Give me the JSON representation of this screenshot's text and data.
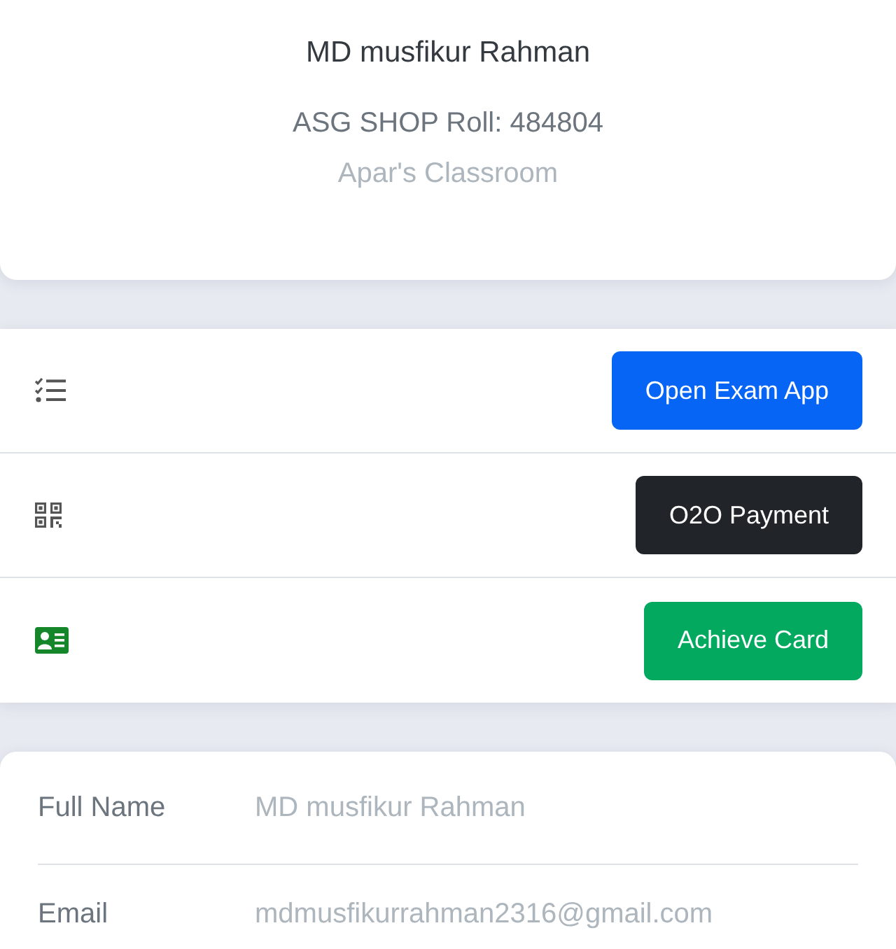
{
  "profile": {
    "name": "MD musfikur Rahman",
    "roll": "ASG SHOP Roll: 484804",
    "classroom": "Apar's Classroom"
  },
  "actions": [
    {
      "kind": "exam",
      "button": "Open Exam App"
    },
    {
      "kind": "payment",
      "button": "O2O Payment"
    },
    {
      "kind": "card",
      "button": "Achieve Card"
    }
  ],
  "details": [
    {
      "label": "Full Name",
      "value": "MD musfikur Rahman"
    },
    {
      "label": "Email",
      "value": "mdmusfikurrahman2316@gmail.com"
    }
  ]
}
